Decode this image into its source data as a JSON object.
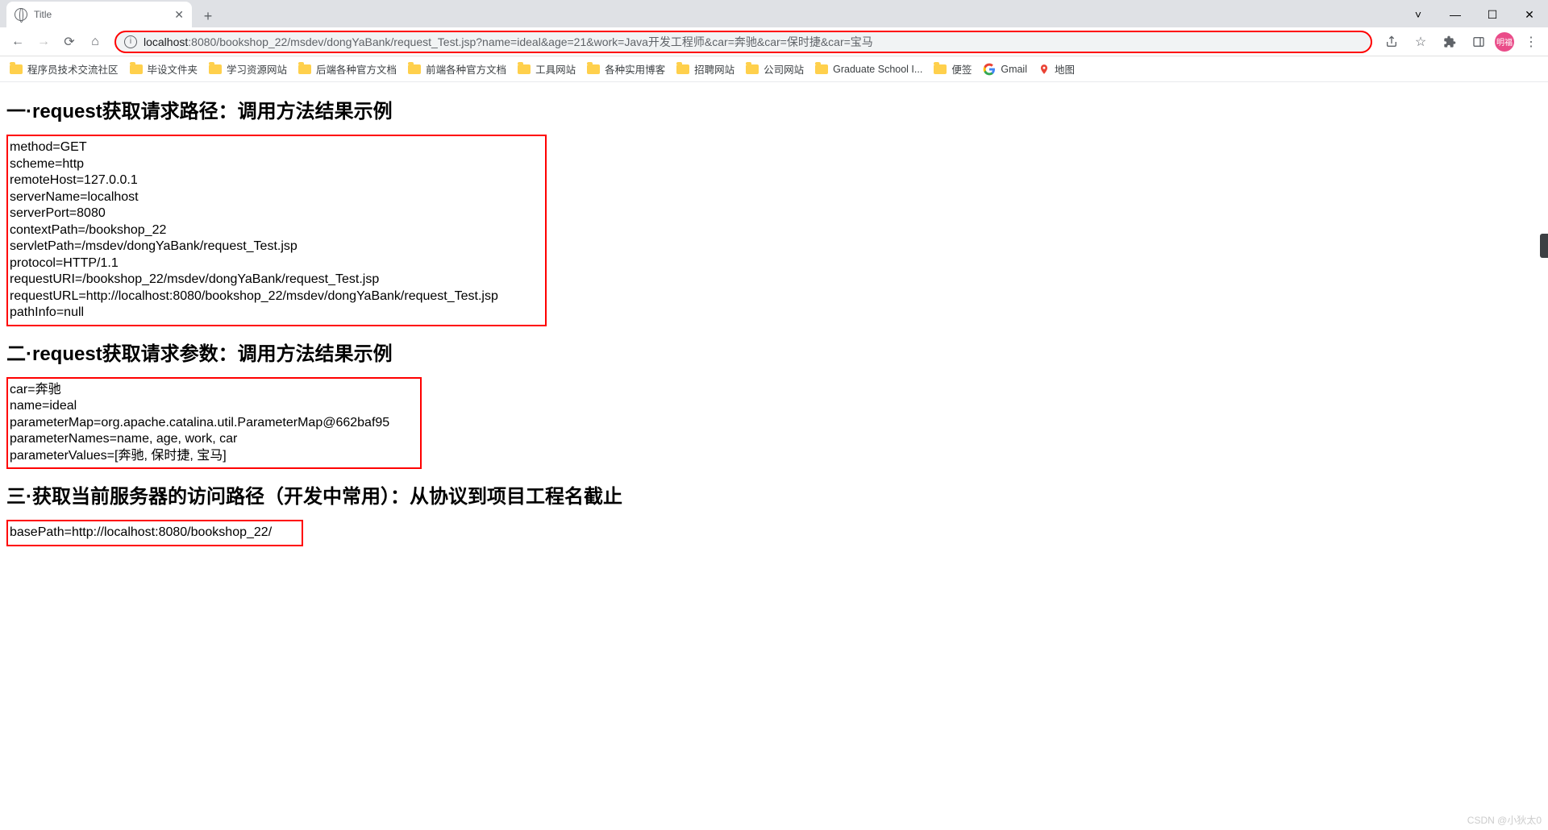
{
  "window": {
    "tab_title": "Title",
    "min": "—",
    "max": "☐",
    "close": "✕"
  },
  "toolbar": {
    "url_host": "localhost",
    "url_rest": ":8080/bookshop_22/msdev/dongYaBank/request_Test.jsp?name=ideal&age=21&work=Java开发工程师&car=奔驰&car=保时捷&car=宝马",
    "avatar_text": "明福"
  },
  "bookmarks": [
    "程序员技术交流社区",
    "毕设文件夹",
    "学习资源网站",
    "后端各种官方文档",
    "前端各种官方文档",
    "工具网站",
    "各种实用博客",
    "招聘网站",
    "公司网站",
    "Graduate School I...",
    "便签"
  ],
  "bm_gmail": "Gmail",
  "bm_map": "地图",
  "section1": {
    "title": "一·request获取请求路径：调用方法结果示例",
    "lines": [
      "method=GET",
      "scheme=http",
      "remoteHost=127.0.0.1",
      "serverName=localhost",
      "serverPort=8080",
      "contextPath=/bookshop_22",
      "servletPath=/msdev/dongYaBank/request_Test.jsp",
      "protocol=HTTP/1.1",
      "requestURI=/bookshop_22/msdev/dongYaBank/request_Test.jsp",
      "requestURL=http://localhost:8080/bookshop_22/msdev/dongYaBank/request_Test.jsp",
      "pathInfo=null"
    ]
  },
  "section2": {
    "title": "二·request获取请求参数：调用方法结果示例",
    "lines": [
      "car=奔驰",
      "name=ideal",
      "parameterMap=org.apache.catalina.util.ParameterMap@662baf95",
      "parameterNames=name, age, work, car",
      "parameterValues=[奔驰, 保时捷, 宝马]"
    ]
  },
  "section3": {
    "title": "三·获取当前服务器的访问路径（开发中常用）：从协议到项目工程名截止",
    "lines": [
      "basePath=http://localhost:8080/bookshop_22/"
    ]
  },
  "watermark": "CSDN @小狄太0"
}
